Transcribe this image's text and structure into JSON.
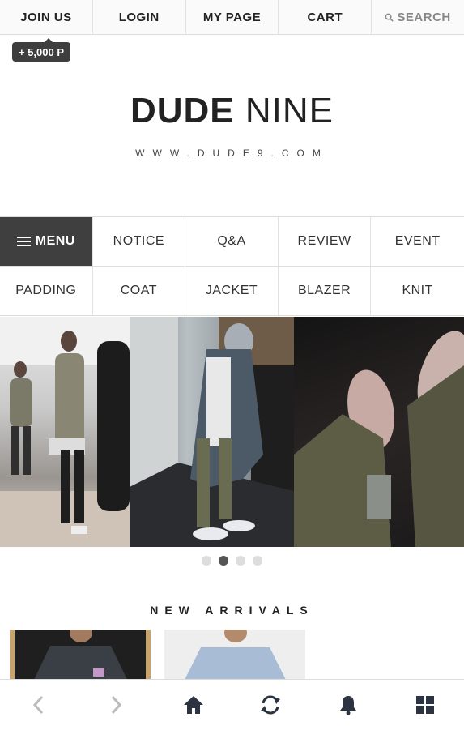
{
  "topbar": {
    "join": "JOIN US",
    "login": "LOGIN",
    "mypage": "MY PAGE",
    "cart": "CART",
    "search": "SEARCH",
    "search_icon": "search-icon"
  },
  "points_badge": "+ 5,000 P",
  "brand": {
    "bold": "DUDE",
    "light": "NINE",
    "url": "WWW.DUDE9.COM"
  },
  "menu": {
    "menu_label": "MENU",
    "row1": [
      "NOTICE",
      "Q&A",
      "REVIEW",
      "EVENT"
    ],
    "row2": [
      "PADDING",
      "COAT",
      "JACKET",
      "BLAZER",
      "KNIT"
    ]
  },
  "carousel": {
    "total": 4,
    "active": 2
  },
  "section_title": "NEW ARRIVALS",
  "bottom_nav": [
    "back-arrow-icon",
    "forward-arrow-icon",
    "home-icon",
    "refresh-icon",
    "bell-icon",
    "grid-icon"
  ],
  "colors": {
    "dark": "#3f3f3f",
    "icon": "#2b3440",
    "disabled": "#bbbbbb"
  }
}
